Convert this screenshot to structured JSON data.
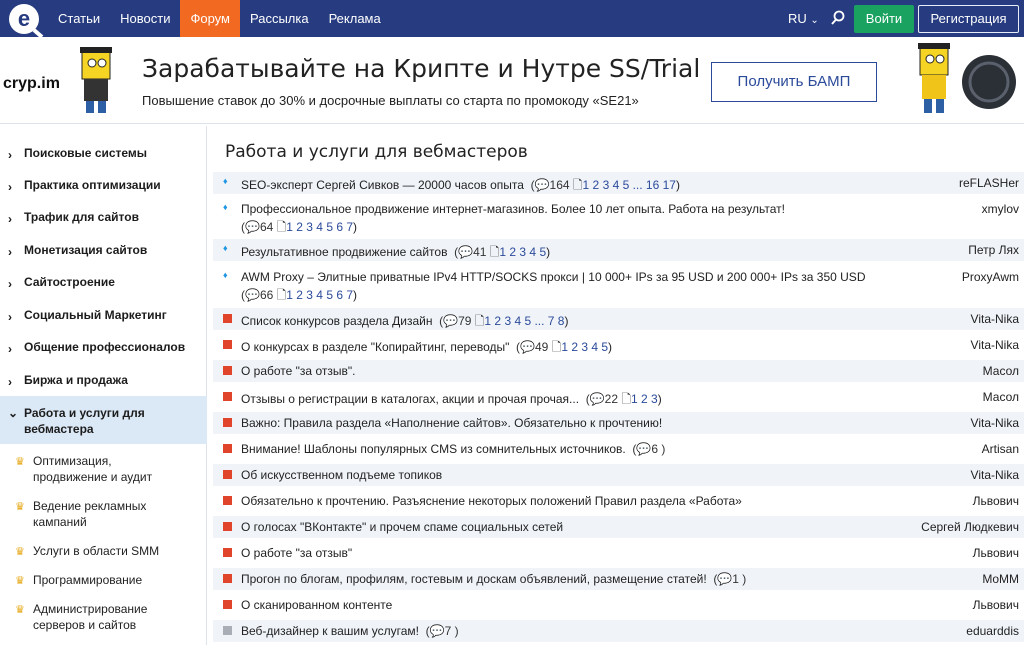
{
  "nav": {
    "links": [
      "Статьи",
      "Новости",
      "Форум",
      "Рассылка",
      "Реклама"
    ],
    "lang": "RU",
    "login": "Войти",
    "register": "Регистрация",
    "accent": "#f26a22",
    "bg": "#263b80"
  },
  "banner": {
    "brand": "cryp.im",
    "title": "Зарабатывайте на Крипте и Нутре SS/Trial",
    "subtitle": "Повышение ставок до 30% и досрочные выплаты со старта по промокоду «SE21»",
    "button": "Получить БАМП"
  },
  "sidebar": {
    "items": [
      "Поисковые системы",
      "Практика оптимизации",
      "Трафик для сайтов",
      "Монетизация сайтов",
      "Сайтостроение",
      "Социальный Маркетинг",
      "Общение профессионалов",
      "Биржа и продажа"
    ],
    "active_line1": "Работа и услуги для",
    "active_line2": "вебмастера",
    "subs": [
      {
        "l1": "Оптимизация,",
        "l2": "продвижение и аудит"
      },
      {
        "l1": "Ведение рекламных",
        "l2": "кампаний"
      },
      {
        "l1": "Услуги в области SMM",
        "l2": ""
      },
      {
        "l1": "Программирование",
        "l2": ""
      },
      {
        "l1": "Администрирование",
        "l2": "серверов и сайтов"
      }
    ]
  },
  "main": {
    "title": "Работа и услуги для вебмастеров",
    "topics": [
      {
        "title": "SEO-эксперт Сергей Сивков — 20000 часов опыта",
        "meta": "(💬164  🗋",
        "pages": "1 2 3 4 5 ... 16 17",
        "tail": ")",
        "author": "reFLASHer"
      },
      {
        "title": "Профессиональное продвижение интернет-магазинов. Более 10 лет опыта. Работа на результат!",
        "meta": "(💬64  🗋",
        "pages": "1 2 3 4 5 6 7",
        "tail": ")",
        "author": "xmylov"
      },
      {
        "title": "Результативное продвижение сайтов",
        "meta": "(💬41  🗋",
        "pages": "1 2 3 4 5",
        "tail": ")",
        "author": "Петр Лях"
      },
      {
        "title": "AWM Proxy – Элитные приватные IPv4 HTTP/SOCKS прокси | 10 000+ IPs за 95 USD и 200 000+ IPs за 350 USD",
        "meta": "(💬66  🗋",
        "pages": "1 2 3 4 5 6 7",
        "tail": ")",
        "author": "ProxyAwm"
      },
      {
        "title": "Список конкурсов раздела Дизайн",
        "meta": "(💬79  🗋",
        "pages": "1 2 3 4 5 ... 7 8",
        "tail": ")",
        "author": "Vita-Nika"
      },
      {
        "title": "О конкурсах в разделе \"Копирайтинг, переводы\"",
        "meta": "(💬49  🗋",
        "pages": "1 2 3 4 5",
        "tail": ")",
        "author": "Vita-Nika"
      },
      {
        "title": "О работе \"за отзыв\".",
        "meta": "",
        "pages": "",
        "tail": "",
        "author": "Масол"
      },
      {
        "title": "Отзывы о регистрации в каталогах, акции и прочая прочая...",
        "meta": "(💬22  🗋",
        "pages": "1 2 3",
        "tail": ")",
        "author": "Масол"
      },
      {
        "title": "Важно: Правила раздела «Наполнение сайтов». Обязательно к прочтению!",
        "meta": "",
        "pages": "",
        "tail": "",
        "author": "Vita-Nika"
      },
      {
        "title": "Внимание! Шаблоны популярных CMS из сомнительных источников.",
        "meta": "(💬6 )",
        "pages": "",
        "tail": "",
        "author": "Artisan"
      },
      {
        "title": "Об искусственном подъеме топиков",
        "meta": "",
        "pages": "",
        "tail": "",
        "author": "Vita-Nika"
      },
      {
        "title": "Обязательно к прочтению. Разъяснение некоторых положений Правил раздела «Работа»",
        "meta": "",
        "pages": "",
        "tail": "",
        "author": "Львович"
      },
      {
        "title": "О голосах \"ВКонтакте\" и прочем спаме социальных сетей",
        "meta": "",
        "pages": "",
        "tail": "",
        "author": "Сергей Людкевич"
      },
      {
        "title": "О работе \"за отзыв\"",
        "meta": "",
        "pages": "",
        "tail": "",
        "author": "Львович"
      },
      {
        "title": "Прогон по блогам, профилям, гостевым и доскам объявлений, размещение статей!",
        "meta": "(💬1 )",
        "pages": "",
        "tail": "",
        "author": "MoMM"
      },
      {
        "title": "О сканированном контенте",
        "meta": "",
        "pages": "",
        "tail": "",
        "author": "Львович"
      },
      {
        "title": "Веб-дизайнер к вашим услугам!",
        "meta": "(💬7 )",
        "pages": "",
        "tail": "",
        "author": "eduarddis"
      }
    ]
  }
}
